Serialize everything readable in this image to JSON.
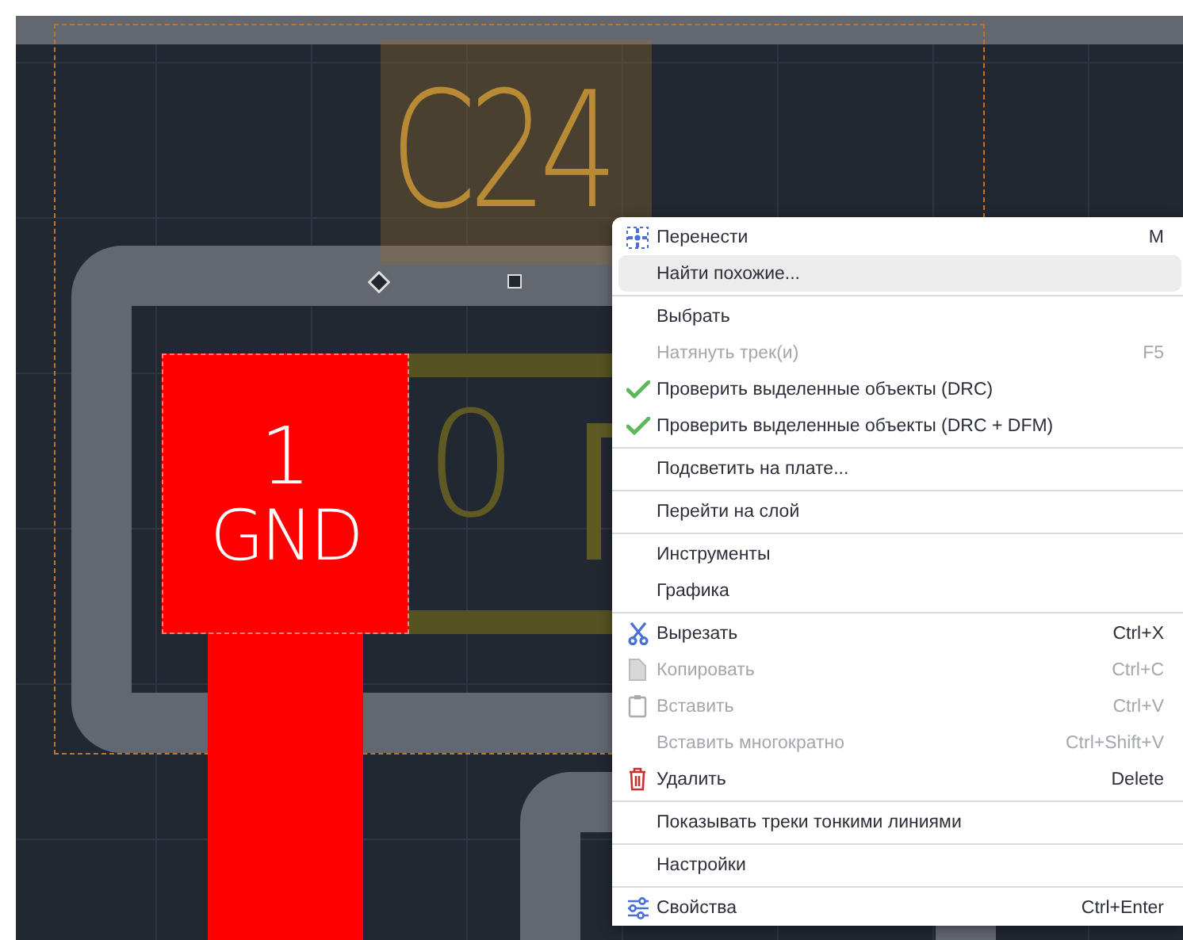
{
  "canvas": {
    "component_label": "C24",
    "pad": {
      "number": "1",
      "net": "GND"
    },
    "value_text": "0"
  },
  "context_menu": {
    "items": [
      {
        "kind": "item",
        "label": "Перенести",
        "shortcut": "M",
        "disabled": false,
        "selected": false
      },
      {
        "kind": "item",
        "label": "Найти похожие...",
        "disabled": false,
        "selected": true
      },
      {
        "kind": "separator"
      },
      {
        "kind": "item",
        "label": "Выбрать",
        "disabled": false,
        "selected": false
      },
      {
        "kind": "item",
        "label": "Натянуть трек(и)",
        "shortcut": "F5",
        "disabled": true,
        "selected": false
      },
      {
        "kind": "item",
        "label": "Проверить выделенные объекты (DRC)",
        "disabled": false,
        "selected": false
      },
      {
        "kind": "item",
        "label": "Проверить выделенные объекты (DRC + DFM)",
        "disabled": false,
        "selected": false
      },
      {
        "kind": "separator"
      },
      {
        "kind": "item",
        "label": "Подсветить на плате...",
        "disabled": false,
        "selected": false
      },
      {
        "kind": "separator"
      },
      {
        "kind": "item",
        "label": "Перейти на слой",
        "disabled": false,
        "selected": false
      },
      {
        "kind": "separator"
      },
      {
        "kind": "item",
        "label": "Инструменты",
        "disabled": false,
        "selected": false
      },
      {
        "kind": "item",
        "label": "Графика",
        "disabled": false,
        "selected": false
      },
      {
        "kind": "separator"
      },
      {
        "kind": "item",
        "label": "Вырезать",
        "shortcut": "Ctrl+X",
        "disabled": false,
        "selected": false
      },
      {
        "kind": "item",
        "label": "Копировать",
        "shortcut": "Ctrl+C",
        "disabled": true,
        "selected": false
      },
      {
        "kind": "item",
        "label": "Вставить",
        "shortcut": "Ctrl+V",
        "disabled": true,
        "selected": false
      },
      {
        "kind": "item",
        "label": "Вставить многократно",
        "shortcut": "Ctrl+Shift+V",
        "disabled": true,
        "selected": false
      },
      {
        "kind": "item",
        "label": "Удалить",
        "shortcut": "Delete",
        "disabled": false,
        "selected": false
      },
      {
        "kind": "separator"
      },
      {
        "kind": "item",
        "label": "Показывать треки тонкими линиями",
        "disabled": false,
        "selected": false
      },
      {
        "kind": "separator"
      },
      {
        "kind": "item",
        "label": "Настройки",
        "disabled": false,
        "selected": false
      },
      {
        "kind": "separator"
      },
      {
        "kind": "item",
        "label": "Свойства",
        "shortcut": "Ctrl+Enter",
        "disabled": false,
        "selected": false
      }
    ]
  }
}
